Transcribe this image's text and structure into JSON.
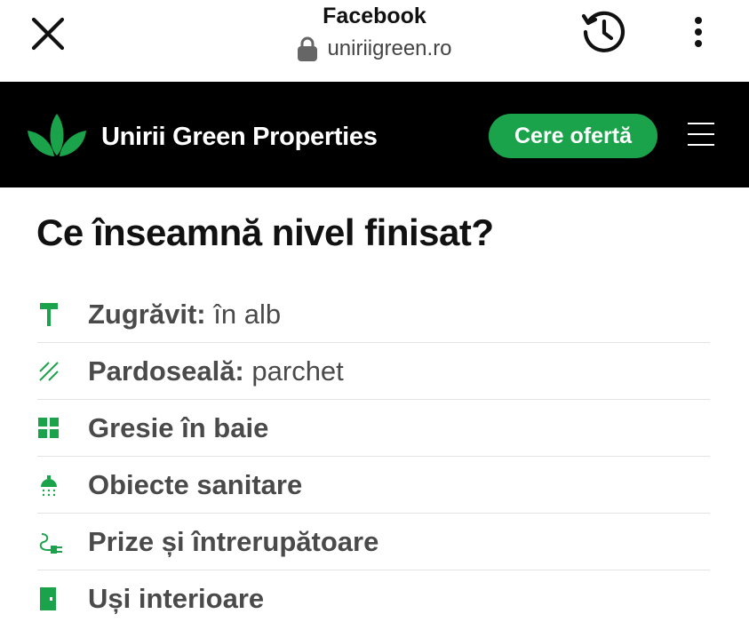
{
  "browser": {
    "title": "Facebook",
    "url": "uniriigreen.ro",
    "icons": [
      "close-icon",
      "lock-icon",
      "history-icon",
      "more-vertical-icon"
    ]
  },
  "header": {
    "brand": "Unirii Green Properties",
    "cta_label": "Cere ofertă",
    "accent_color": "#1aa34a",
    "background_color": "#000000",
    "icons": [
      "leaf-logo-icon",
      "hamburger-menu-icon"
    ]
  },
  "content": {
    "heading": "Ce înseamnă nivel finisat?",
    "features": [
      {
        "label": "Zugrăvit:",
        "value": "în alb",
        "icon": "paint-roller-icon"
      },
      {
        "label": "Pardoseală:",
        "value": "parchet",
        "icon": "floor-hatch-icon"
      },
      {
        "label": "Gresie în baie",
        "value": "",
        "icon": "tiles-icon"
      },
      {
        "label": "Obiecte sanitare",
        "value": "",
        "icon": "shower-icon"
      },
      {
        "label": "Prize și întrerupătoare",
        "value": "",
        "icon": "plug-icon"
      },
      {
        "label": "Uși interioare",
        "value": "",
        "icon": "door-icon"
      }
    ]
  }
}
